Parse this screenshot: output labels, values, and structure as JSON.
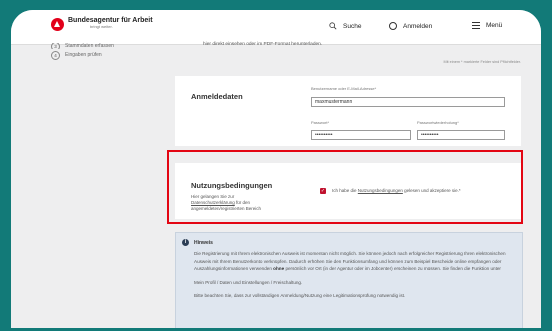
{
  "header": {
    "logo_name": "Bundesagentur für Arbeit",
    "logo_tagline": "bringt weiter.",
    "search_label": "Suche",
    "login_label": "Anmelden",
    "menu_label": "Menü"
  },
  "sidebar": {
    "items": [
      {
        "num": "3",
        "label": "Stammdaten erfassen"
      },
      {
        "num": "4",
        "label": "Eingaben prüfen"
      }
    ]
  },
  "intro": {
    "text": "hier direkt einsehen oder im PDF-Format herunterladen.",
    "note": "Mit einem * markierte Felder sind Pflichtfelder."
  },
  "login": {
    "title": "Anmeldedaten",
    "username_label": "Benutzername oder E-Mail-Adresse*",
    "username_value": "maxmustermann",
    "password_label": "Passwort*",
    "password_value": "••••••••••",
    "password_confirm_label": "Passwortwiederholung*",
    "password_confirm_value": "••••••••••"
  },
  "terms": {
    "title": "Nutzungsbedingungen",
    "desc_before": "Hier gelangen Sie zur",
    "desc_link": "Datenschutzerklärung",
    "desc_after": "für den angemeldeten/registrierten Bereich",
    "checkbox_before": "Ich habe die",
    "checkbox_link": "Nutzungsbedingungen",
    "checkbox_after": "gelesen und akzeptiere sie.*"
  },
  "notice": {
    "title": "Hinweis",
    "para1_before": "Die Registrierung mit Ihrem elektronischen Ausweis ist momentan nicht möglich. Sie können jedoch nach erfolgreicher Registrierung Ihren elektronischen Ausweis mit Ihrem Benutzerkonto verknüpfen. Dadurch erhöhen Sie den Funktionsumfang und können zum Beispiel Bescheide online empfangen oder Auszahlungsinformationen verwenden",
    "para1_bold": "ohne",
    "para1_after": "persönlich vor Ort (in der Agentur oder im Jobcenter) erscheinen zu müssen. Sie finden die Funktion unter",
    "para2": "Mein Profil / Daten und Einstellungen / Freischaltung.",
    "para3": "Bitte beachten Sie, dass zur vollständigen Anmeldung/Nutzung eine Legitimationsprüfung notwendig ist."
  },
  "colors": {
    "accent_red": "#e30613",
    "brand_red": "#e2001a",
    "checkbox": "#c0112e",
    "background_teal": "#127a78"
  }
}
